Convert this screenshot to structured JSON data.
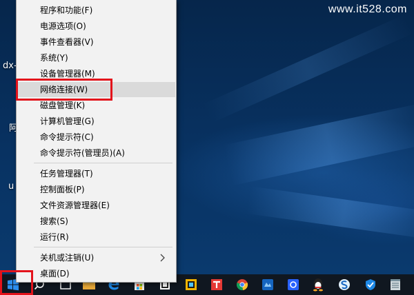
{
  "watermark": "www.it528.com",
  "desktop": {
    "labels": [
      "dx-",
      "阿",
      "u"
    ]
  },
  "context_menu": {
    "groups": [
      [
        {
          "label": "程序和功能(F)"
        },
        {
          "label": "电源选项(O)"
        },
        {
          "label": "事件查看器(V)"
        },
        {
          "label": "系统(Y)"
        },
        {
          "label": "设备管理器(M)"
        },
        {
          "label": "网络连接(W)",
          "highlighted": true
        },
        {
          "label": "磁盘管理(K)"
        },
        {
          "label": "计算机管理(G)"
        },
        {
          "label": "命令提示符(C)"
        },
        {
          "label": "命令提示符(管理员)(A)"
        }
      ],
      [
        {
          "label": "任务管理器(T)"
        },
        {
          "label": "控制面板(P)"
        },
        {
          "label": "文件资源管理器(E)"
        },
        {
          "label": "搜索(S)"
        },
        {
          "label": "运行(R)"
        }
      ],
      [
        {
          "label": "关机或注销(U)",
          "submenu": true
        },
        {
          "label": "桌面(D)"
        }
      ]
    ]
  },
  "taskbar": {
    "icons": [
      "start-button-icon",
      "search-icon",
      "task-view-icon",
      "folder-icon",
      "edge-icon",
      "store-icon",
      "app-icon",
      "app-icon",
      "tt-icon",
      "chrome-icon",
      "blue-app-icon",
      "photo-app-icon",
      "cloud-icon",
      "qq-icon",
      "sogou-icon",
      "shield-icon",
      "notepad-icon"
    ]
  },
  "colors": {
    "highlight_box": "#e3131b",
    "menu_bg": "#f2f2f2",
    "menu_hover": "#dadada",
    "taskbar": "#101720"
  }
}
